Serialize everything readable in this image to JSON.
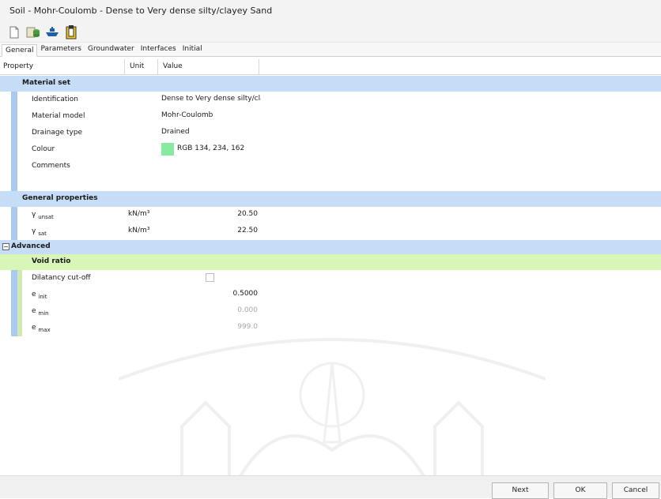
{
  "window": {
    "title": "Soil - Mohr-Coulomb - Dense to Very dense silty/clayey Sand"
  },
  "toolbar": {
    "icons": [
      "new-document-icon",
      "open-database-icon",
      "ship-icon",
      "clipboard-icon"
    ]
  },
  "tabs": [
    {
      "label": "General",
      "active": true
    },
    {
      "label": "Parameters",
      "active": false
    },
    {
      "label": "Groundwater",
      "active": false
    },
    {
      "label": "Interfaces",
      "active": false
    },
    {
      "label": "Initial",
      "active": false
    }
  ],
  "columns": {
    "property": "Property",
    "unit": "Unit",
    "value": "Value"
  },
  "sections": {
    "material_set": {
      "title": "Material set",
      "identification": {
        "label": "Identification",
        "value": "Dense to Very dense silty/clayey Sand"
      },
      "material_model": {
        "label": "Material model",
        "value": "Mohr-Coulomb"
      },
      "drainage_type": {
        "label": "Drainage type",
        "value": "Drained"
      },
      "colour": {
        "label": "Colour",
        "value": "RGB 134, 234, 162",
        "hex": "#86eaa2"
      },
      "comments": {
        "label": "Comments",
        "value": ""
      }
    },
    "general_properties": {
      "title": "General properties",
      "gamma_unsat": {
        "symbol": "γ",
        "sub": "unsat",
        "unit": "kN/m³",
        "value": "20.50"
      },
      "gamma_sat": {
        "symbol": "γ",
        "sub": "sat",
        "unit": "kN/m³",
        "value": "22.50"
      }
    },
    "advanced": {
      "title": "Advanced",
      "expander": "−",
      "void_ratio": {
        "title": "Void ratio",
        "dilatancy_cutoff": {
          "label": "Dilatancy cut-off",
          "checked": false
        },
        "e_init": {
          "symbol": "e",
          "sub": "init",
          "value": "0.5000"
        },
        "e_min": {
          "symbol": "e",
          "sub": "min",
          "value": "0.000"
        },
        "e_max": {
          "symbol": "e",
          "sub": "max",
          "value": "999.0"
        }
      }
    }
  },
  "buttons": {
    "next": "Next",
    "ok": "OK",
    "cancel": "Cancel"
  },
  "colors": {
    "section_blue": "#c5ddf6",
    "section_green": "#d8f6b7",
    "stripe_blue": "#a9c9ee"
  }
}
